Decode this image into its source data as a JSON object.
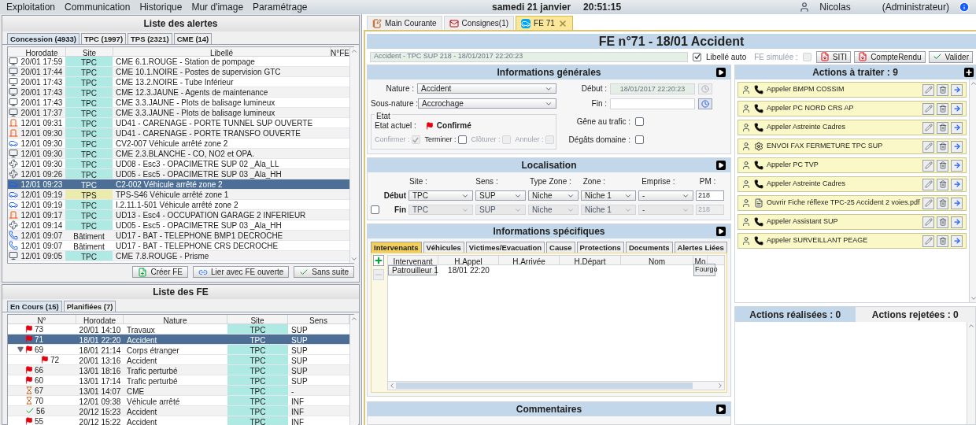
{
  "menu": [
    "Exploitation",
    "Communication",
    "Historique",
    "Mur d'image",
    "Paramétrage"
  ],
  "header": {
    "date": "samedi 21 janvier",
    "time": "20:51:15",
    "user": "Nicolas",
    "role": "(Administrateur)"
  },
  "alerts": {
    "title": "Liste des alertes",
    "tabs": [
      {
        "label": "Concession (4933)",
        "selected": true
      },
      {
        "label": "TPC (1997)",
        "selected": false
      },
      {
        "label": "TPS (2321)",
        "selected": false
      },
      {
        "label": "CME (14)",
        "selected": false
      }
    ],
    "columns": [
      "Horodate",
      "Site",
      "Libellé",
      "N°FE"
    ],
    "rows": [
      {
        "kind": "display",
        "time": "20/01 17:59",
        "site": "TPC",
        "color": "#aeeae3",
        "label": "CME 6.1.ROUGE - Station de pompage",
        "selected": false
      },
      {
        "kind": "display",
        "time": "20/01 17:44",
        "site": "TPC",
        "color": "#aeeae3",
        "label": "CME 10.1.NOIRE - Postes de supervision GTC",
        "selected": false
      },
      {
        "kind": "display",
        "time": "20/01 17:43",
        "site": "TPC",
        "color": "#aeeae3",
        "label": "CME 13.2.NOIRE - Tube Inférieur",
        "selected": false
      },
      {
        "kind": "display",
        "time": "20/01 17:43",
        "site": "TPC",
        "color": "#aeeae3",
        "label": "CME 12.3.JAUNE - Agents de maintenance",
        "selected": false
      },
      {
        "kind": "display",
        "time": "20/01 17:43",
        "site": "TPC",
        "color": "#aeeae3",
        "label": "CME 3.3.JAUNE - Plots de balisage lumineux",
        "selected": false
      },
      {
        "kind": "display",
        "time": "20/01 17:37",
        "site": "TPC",
        "color": "#aeeae3",
        "label": "CME 3.3.JAUNE - Plots de balisage lumineux",
        "selected": false
      },
      {
        "kind": "door",
        "time": "12/01 09:31",
        "site": "TPC",
        "color": "#aeeae3",
        "label": "UD41 - CARENAGE - PORTE TUNNEL SUP OUVERTE",
        "selected": false
      },
      {
        "kind": "door",
        "time": "12/01 09:30",
        "site": "TPC",
        "color": "#aeeae3",
        "label": "UD41 - CARENAGE - PORTE TRANSFO OUVERTE",
        "selected": false
      },
      {
        "kind": "vehicle",
        "time": "12/01 09:30",
        "site": "TPC",
        "color": "#aeeae3",
        "label": "CV2-007 Véhicule arrêté zone 2",
        "selected": false
      },
      {
        "kind": "display",
        "time": "12/01 09:30",
        "site": "TPC",
        "color": "#aeeae3",
        "label": "CME 2.3.BLANCHE - CO, NO2 et OPA.",
        "selected": false
      },
      {
        "kind": "fan",
        "time": "12/01 09:30",
        "site": "TPC",
        "color": "#aeeae3",
        "label": "UD08 - Esc3 - OPACIMETRE SUP 02 _Ala_LL",
        "selected": false
      },
      {
        "kind": "fan",
        "time": "12/01 09:26",
        "site": "TPC",
        "color": "#aeeae3",
        "label": "UD05 - Esc5 - OPACIMETRE SUP 03 _Ala_HH",
        "selected": false
      },
      {
        "kind": "vehicle",
        "time": "12/01 09:23",
        "site": "TPC",
        "label": "C2-002 Véhicule arrêté zone 2",
        "selected": true
      },
      {
        "kind": "vehicle",
        "time": "12/01 09:19",
        "site": "TPS",
        "color": "#ecebae",
        "label": "TPS-S46 Véhicule arrêté zone 1",
        "selected": false
      },
      {
        "kind": "vehicle",
        "time": "12/01 09:19",
        "site": "TPC",
        "color": "#aeeae3",
        "label": "I.2.11.1-501 Véhicule arrêté zone 2",
        "selected": false
      },
      {
        "kind": "door",
        "time": "12/01 09:17",
        "site": "TPC",
        "color": "#aeeae3",
        "label": "UD13 - Esc4 - OCCUPATION GARAGE 2 INFERIEUR",
        "selected": false
      },
      {
        "kind": "fan",
        "time": "12/01 09:14",
        "site": "TPC",
        "color": "#aeeae3",
        "label": "UD05 - Esc5 - OPACIMETRE SUP 03 _Ala_HH",
        "selected": false
      },
      {
        "kind": "phone",
        "time": "12/01 09:07",
        "site": "Bâtiment",
        "label": "UD17 - BAT - TELEPHONE BMP1 DECROCHE",
        "selected": false
      },
      {
        "kind": "phone",
        "time": "12/01 09:07",
        "site": "Bâtiment",
        "label": "UD17 - BAT - TELEPHONE CRS DECROCHE",
        "selected": false
      },
      {
        "kind": "display",
        "time": "12/01 09:05",
        "site": "TPC",
        "color": "#aeeae3",
        "label": "CME 7.8.ROUGE - Prisme",
        "selected": false
      }
    ],
    "buttons": [
      {
        "kind": "create",
        "label": "Créer FE"
      },
      {
        "kind": "link",
        "label": "Lier avec FE ouverte"
      },
      {
        "kind": "dismiss",
        "label": "Sans suite"
      }
    ]
  },
  "fe_list": {
    "title": "Liste des FE",
    "tabs": [
      {
        "label": "En Cours (15)",
        "selected": true
      },
      {
        "label": "Planifiées (7)",
        "selected": false
      }
    ],
    "columns": [
      "N°",
      "Horodate",
      "Nature",
      "Site",
      "Sens"
    ],
    "rows": [
      {
        "kind": "flag",
        "number": "73",
        "time": "20/01 14:10",
        "nature": "Travaux",
        "site": "TPC",
        "color": "#aeeae3",
        "sens": "SUP",
        "selected": false
      },
      {
        "kind": "flag",
        "number": "71",
        "time": "18/01 22:20",
        "nature": "Accident",
        "site": "TPC",
        "sens": "SUP",
        "selected": true
      },
      {
        "kind": "flag",
        "number": "69",
        "time": "18/01 21:14",
        "nature": "Corps étranger",
        "site": "TPC",
        "color": "#aeeae3",
        "sens": "SUP",
        "selected": false,
        "expanded": true,
        "children": [
          {
            "kind": "flag",
            "number": "72",
            "time": "20/01 13:16",
            "nature": "Accident",
            "site": "TPC",
            "color": "#aeeae3",
            "sens": "SUP",
            "selected": false
          }
        ]
      },
      {
        "kind": "flag",
        "number": "66",
        "time": "13/01 18:16",
        "nature": "Trafic perturbé",
        "site": "TPC",
        "color": "#aeeae3",
        "sens": "SUP",
        "selected": false
      },
      {
        "kind": "flag",
        "number": "60",
        "time": "13/01 17:14",
        "nature": "Trafic perturbé",
        "site": "TPC",
        "color": "#aeeae3",
        "sens": "SUP",
        "selected": false
      },
      {
        "kind": "pending",
        "number": "67",
        "time": "13/01 14:07",
        "nature": "CME",
        "site": "TPC",
        "color": "#aeeae3",
        "sens": "-",
        "selected": false
      },
      {
        "kind": "pending",
        "number": "70",
        "time": "12/01 09:38",
        "nature": "Véhicule arrêté",
        "site": "TPC",
        "color": "#aeeae3",
        "sens": "INF",
        "selected": false
      },
      {
        "kind": "done",
        "number": "56",
        "time": "20/12 15:23",
        "nature": "Accident",
        "site": "TPC",
        "color": "#aeeae3",
        "sens": "INF",
        "selected": false
      },
      {
        "kind": "flag",
        "number": "55",
        "time": "20/12 15:22",
        "nature": "Accident",
        "site": "TPC",
        "color": "#aeeae3",
        "sens": "INF",
        "selected": false
      }
    ]
  },
  "doc_tabs": [
    {
      "kind": "log",
      "label": "Main Courante",
      "selected": false,
      "closable": false
    },
    {
      "kind": "mail",
      "label": "Consignes(1)",
      "selected": false,
      "closable": false
    },
    {
      "kind": "vehicle",
      "label": "FE 71",
      "selected": true,
      "closable": true
    }
  ],
  "fe": {
    "title": "FE n°71 - 18/01 Accident",
    "libelle": {
      "value": "Accident - TPC SUP 218 - 18/01/2017 22:20:23",
      "disabled": true
    },
    "libelle_auto": {
      "label": "Libellé auto",
      "checked": true
    },
    "simulee": {
      "label": "FE simulée :",
      "checked": false,
      "disabled": true
    },
    "buttons": [
      {
        "kind": "pdf",
        "label": "SITI"
      },
      {
        "kind": "pdf",
        "label": "CompteRendu"
      },
      {
        "kind": "check",
        "label": "Valider"
      }
    ],
    "general": {
      "title": "Informations générales",
      "nature": {
        "label": "Nature :",
        "value": "Accident"
      },
      "sous_nature": {
        "label": "Sous-nature :",
        "value": "Accrochage"
      },
      "etat": {
        "legend": "Etat",
        "current_label": "Etat actuel :",
        "current": "Confirmé",
        "options": [
          {
            "label": "Confirmer :",
            "checked": true,
            "disabled": true
          },
          {
            "label": "Terminer :",
            "checked": false,
            "disabled": false
          },
          {
            "label": "Clôturer :",
            "checked": false,
            "disabled": true
          },
          {
            "label": "Annuler :",
            "checked": false,
            "disabled": true
          }
        ]
      },
      "debut": {
        "label": "Début :",
        "value": "18/01/2017 22:20:23",
        "disabled": true
      },
      "fin": {
        "label": "Fin :",
        "disabled": false
      },
      "flags": [
        {
          "label": "Gêne au trafic :",
          "checked": false
        },
        {
          "label": "Dégâts domaine :",
          "checked": false
        }
      ]
    },
    "localisation": {
      "title": "Localisation",
      "columns": [
        "Site :",
        "Sens :",
        "Type Zone :",
        "Zone :",
        "Emprise :",
        "PM :"
      ],
      "rows": [
        {
          "label": "Début",
          "disabled": false,
          "values": [
            "TPC",
            "SUP",
            "Niche",
            "Niche 1",
            "-"
          ],
          "pm": "218"
        },
        {
          "label": "Fin",
          "checked": false,
          "disabled": true,
          "values": [
            "TPC",
            "SUP",
            "Niche",
            "Niche 1",
            "-"
          ],
          "pm": "218"
        }
      ]
    },
    "specific": {
      "title": "Informations spécifiques",
      "tabs": [
        {
          "label": "Intervenants",
          "selected": true
        },
        {
          "label": "Véhicules",
          "selected": false
        },
        {
          "label": "Victimes/Evacuation",
          "selected": false
        },
        {
          "label": "Cause",
          "selected": false
        },
        {
          "label": "Protections",
          "selected": false
        },
        {
          "label": "Documents",
          "selected": false
        },
        {
          "label": "Alertes Liées",
          "selected": false
        }
      ],
      "columns": [
        "Intervenant",
        "H.Appel",
        "H.Arrivée",
        "H.Départ",
        "Nom",
        "Mo"
      ],
      "rows": [
        {
          "intervenant": "Patrouilleur 1",
          "h_appel": "18/01 22:20",
          "column_6": "Fourgo"
        }
      ]
    },
    "comments": {
      "title": "Commentaires"
    }
  },
  "actions": {
    "title": "Actions à traiter : 9",
    "items": [
      {
        "kind": "phone",
        "label": "Appeler BMPM COSSIM"
      },
      {
        "kind": "phone",
        "label": "Appeler PC NORD CRS AP"
      },
      {
        "kind": "phone",
        "label": "Appeler Astreinte Cadres"
      },
      {
        "kind": "gear",
        "label": "ENVOI FAX FERMETURE TPC SUP"
      },
      {
        "kind": "phone",
        "label": "Appeler PC TVP"
      },
      {
        "kind": "phone",
        "label": "Appeler Astreinte Cadres"
      },
      {
        "kind": "document",
        "label": "Ouvrir Fiche réflexe TPC-25 Accident 2 voies.pdf"
      },
      {
        "kind": "phone",
        "label": "Appeler Assistant SUP"
      },
      {
        "kind": "phone",
        "label": "Appeler SURVEILLANT PEAGE"
      }
    ],
    "tabs": [
      {
        "label": "Actions réalisées : 0",
        "selected": true
      },
      {
        "label": "Actions rejetées : 0",
        "selected": false
      }
    ]
  }
}
